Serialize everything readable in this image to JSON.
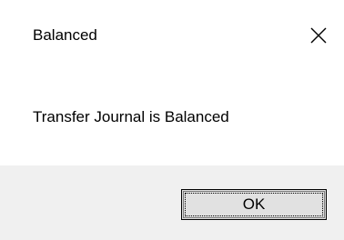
{
  "window": {
    "title": "Balanced",
    "close_icon": "close-icon"
  },
  "message": {
    "text": "Transfer Journal is Balanced"
  },
  "buttons": {
    "ok_label": "OK"
  },
  "colors": {
    "body_bg": "#ffffff",
    "footer_bg": "#f0f0f0",
    "button_bg": "#e1e1e1",
    "text": "#000000"
  }
}
